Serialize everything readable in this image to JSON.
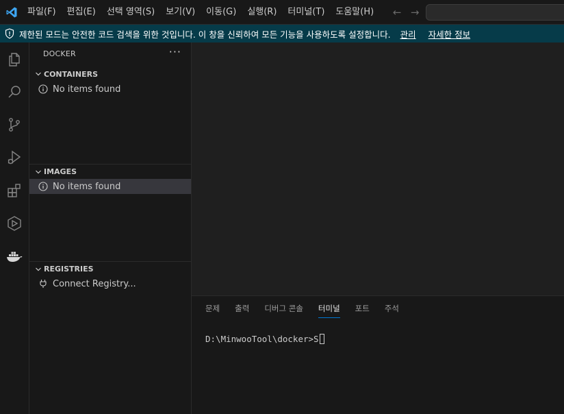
{
  "menu": [
    "파일(F)",
    "편집(E)",
    "선택 영역(S)",
    "보기(V)",
    "이동(G)",
    "실행(R)",
    "터미널(T)",
    "도움말(H)"
  ],
  "banner": {
    "message": "제한된 모드는 안전한 코드 검색을 위한 것입니다. 이 창을 신뢰하여 모든 기능을 사용하도록 설정합니다.",
    "manage_link": "관리",
    "details_link": "자세한 정보"
  },
  "sidebar": {
    "title": "DOCKER",
    "more": "···",
    "containers": {
      "header": "CONTAINERS",
      "empty": "No items found"
    },
    "images": {
      "header": "IMAGES",
      "empty": "No items found"
    },
    "registries": {
      "header": "REGISTRIES",
      "connect": "Connect Registry..."
    }
  },
  "panel": {
    "tabs": [
      "문제",
      "출력",
      "디버그 콘솔",
      "터미널",
      "포트",
      "주석"
    ],
    "active_tab": "터미널",
    "terminal_line": "D:\\MinwooTool\\docker>S"
  },
  "colors": {
    "accent": "#0078d4",
    "banner_bg": "#063b49",
    "logo": "#3ea6f2",
    "selection": "#37373d"
  },
  "icons": {
    "activity_bar": [
      "explorer-icon",
      "search-icon",
      "source-control-icon",
      "run-debug-icon",
      "extensions-icon",
      "remote-explorer-icon",
      "docker-icon"
    ]
  }
}
